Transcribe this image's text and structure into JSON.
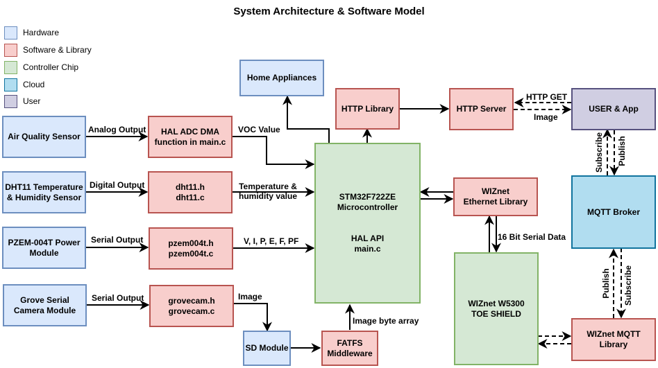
{
  "title": "System Architecture & Software Model",
  "legend": [
    {
      "label": "Hardware",
      "fill": "#dae8fc",
      "stroke": "#6c8ebf"
    },
    {
      "label": "Software & Library",
      "fill": "#f8cecc",
      "stroke": "#b85450"
    },
    {
      "label": "Controller Chip",
      "fill": "#d5e8d4",
      "stroke": "#82b366"
    },
    {
      "label": "Cloud",
      "fill": "#b1ddf0",
      "stroke": "#10739e"
    },
    {
      "label": "User",
      "fill": "#d0cee2",
      "stroke": "#56517e"
    }
  ],
  "nodes": {
    "air_quality_sensor": "Air Quality Sensor",
    "dht11_sensor": "DHT11 Temperature\n& Humidity Sensor",
    "pzem_module": "PZEM-004T Power\nModule",
    "grove_camera": "Grove Serial\nCamera Module",
    "hal_adc": "HAL ADC DMA\nfunction in main.c",
    "dht11_lib": "dht11.h\ndht11.c",
    "pzem_lib": "pzem004t.h\npzem004t.c",
    "grovecam_lib": "grovecam.h\ngrovecam.c",
    "sd_module": "SD Module",
    "fatfs": "FATFS\nMiddleware",
    "home_appliances": "Home Appliances",
    "http_library": "HTTP Library",
    "http_server": "HTTP Server",
    "user_app": "USER & App",
    "mcu": "STM32F722ZE\nMicrocontroller\n\n\nHAL API\nmain.c",
    "wiznet_eth_lib": "WIZnet\nEthernet Library",
    "wiznet_shield": "WIZnet W5300\nTOE SHIELD",
    "mqtt_broker": "MQTT Broker",
    "wiznet_mqtt_lib": "WIZnet MQTT\nLibrary"
  },
  "edge_labels": {
    "analog_output": "Analog Output",
    "digital_output": "Digital Output",
    "serial_output_pzem": "Serial Output",
    "serial_output_cam": "Serial Output",
    "voc_value": "VOC Value",
    "temp_humidity": "Temperature &\nhumidity value",
    "power_values": "V, I, P, E, F, PF",
    "image_to_sd": "Image",
    "image_byte_array": "Image byte array",
    "http_get": "HTTP GET",
    "image_to_user": "Image",
    "serial_data": "16 Bit Serial Data",
    "user_subscribe": "Subscribe",
    "user_publish": "Publish",
    "mqtt_publish": "Publish",
    "mqtt_subscribe": "Subscribe"
  }
}
